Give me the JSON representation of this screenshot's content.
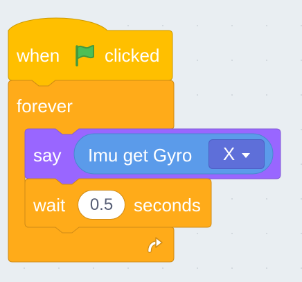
{
  "script": {
    "hat": {
      "when_label": "when",
      "flag_icon": "green-flag-icon",
      "clicked_label": "clicked"
    },
    "forever": {
      "label": "forever",
      "loop_icon": "loop-arrow-icon"
    },
    "say": {
      "label": "say",
      "reporter": {
        "label": "Imu get Gyro",
        "dropdown_value": "X"
      }
    },
    "wait": {
      "label": "wait",
      "value": "0.5",
      "unit_label": "seconds"
    }
  },
  "colors": {
    "workspace_bg": "#e9eef2",
    "events": "#ffbf00",
    "events_border": "#cc9900",
    "control": "#ffab19",
    "control_border": "#cf8b17",
    "extension_purple": "#9966ff",
    "reporter_blue": "#5b9bea",
    "dropdown": "#5e6fd9"
  }
}
